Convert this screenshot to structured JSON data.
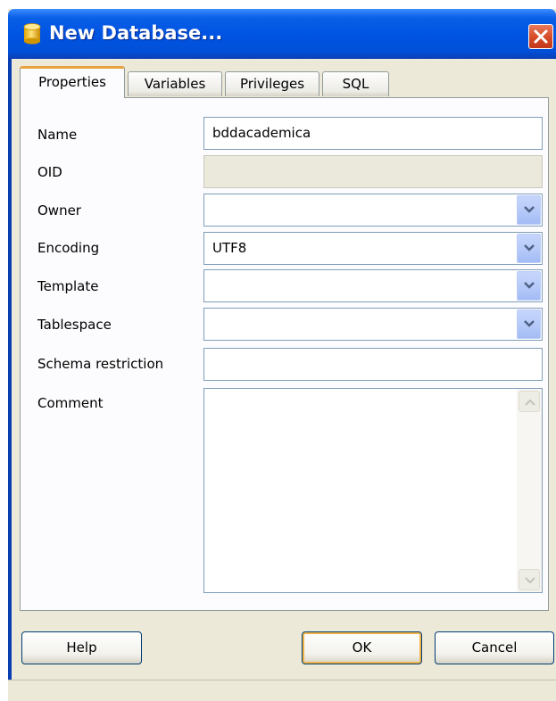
{
  "window": {
    "title": "New Database...",
    "app_icon": "database-icon",
    "close_icon": "close-icon"
  },
  "tabs": [
    {
      "label": "Properties",
      "active": true
    },
    {
      "label": "Variables",
      "active": false
    },
    {
      "label": "Privileges",
      "active": false
    },
    {
      "label": "SQL",
      "active": false
    }
  ],
  "form": {
    "name": {
      "label": "Name",
      "value": "bddacademica"
    },
    "oid": {
      "label": "OID",
      "value": ""
    },
    "owner": {
      "label": "Owner",
      "value": ""
    },
    "encoding": {
      "label": "Encoding",
      "value": "UTF8"
    },
    "template": {
      "label": "Template",
      "value": ""
    },
    "tablespace": {
      "label": "Tablespace",
      "value": ""
    },
    "schema_restriction": {
      "label": "Schema restriction",
      "value": ""
    },
    "comment": {
      "label": "Comment",
      "value": ""
    }
  },
  "buttons": {
    "help": "Help",
    "ok": "OK",
    "cancel": "Cancel"
  },
  "colors": {
    "titlebar": "#0054e3",
    "dialog_bg": "#ece9d8",
    "close_button": "#d54a26",
    "active_tab_accent": "#e8a33d"
  }
}
